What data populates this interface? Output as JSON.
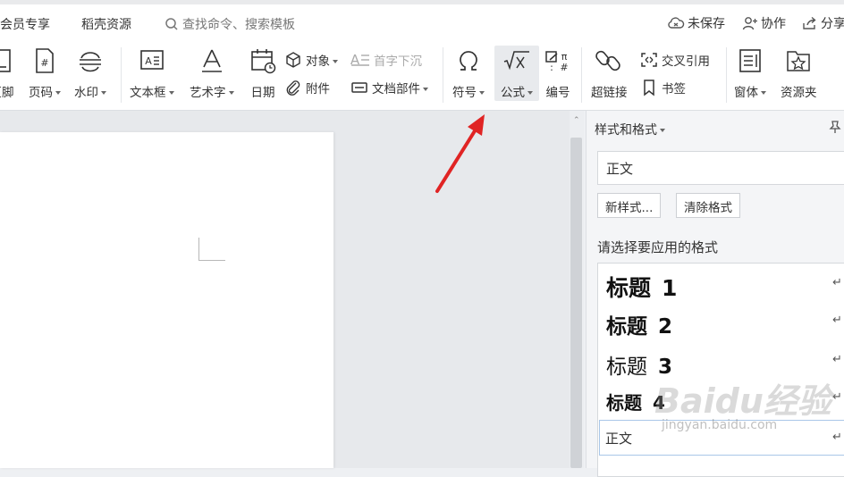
{
  "menubar": {
    "tabs": [
      "会员专享",
      "稻壳资源"
    ],
    "search_placeholder": "查找命令、搜索模板",
    "actions": {
      "unsaved": "未保存",
      "collab": "协作",
      "share": "分享"
    }
  },
  "ribbon": {
    "footer": "页脚",
    "page_number": "页码",
    "watermark": "水印",
    "textbox": "文本框",
    "wordart": "艺术字",
    "date": "日期",
    "object": "对象",
    "dropcap": "首字下沉",
    "attachment": "附件",
    "doc_parts": "文档部件",
    "symbol": "符号",
    "formula": "公式",
    "numbering": "编号",
    "hyperlink": "超链接",
    "cross_ref": "交叉引用",
    "bookmark": "书签",
    "window": "窗体",
    "resource": "资源夹"
  },
  "panel": {
    "title": "样式和格式",
    "current_style": "正文",
    "new_style": "新样式...",
    "clear_format": "清除格式",
    "select_label": "请选择要应用的格式",
    "styles": [
      {
        "name": "标题",
        "num": "1"
      },
      {
        "name": "标题",
        "num": "2"
      },
      {
        "name": "标题",
        "num": "3"
      },
      {
        "name": "标题",
        "num": "4"
      }
    ],
    "selected_style": "正文",
    "return_mark": "↵"
  },
  "watermark": {
    "brand": "Baidu经验",
    "url": "jingyan.baidu.com"
  },
  "colors": {
    "arrow": "#e02424",
    "accent": "#2b7bd6"
  }
}
